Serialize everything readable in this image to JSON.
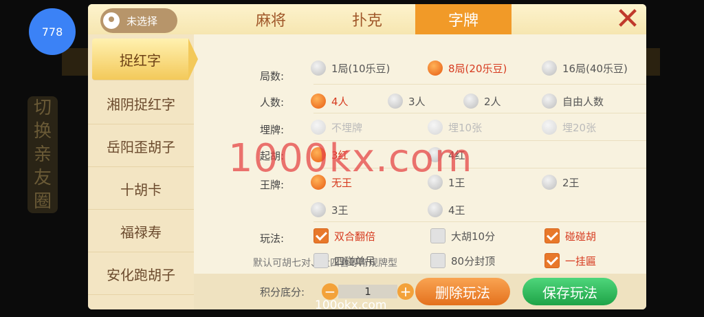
{
  "avatar": {
    "badge": "778"
  },
  "background": {
    "side_label": [
      "切",
      "换",
      "亲",
      "友",
      "圈"
    ]
  },
  "header": {
    "location": "未选择",
    "tabs": [
      {
        "label": "麻将"
      },
      {
        "label": "扑克"
      },
      {
        "label": "字牌"
      }
    ],
    "active_tab": "字牌"
  },
  "sidebar": {
    "items": [
      {
        "label": "捉红字",
        "active": true
      },
      {
        "label": "湘阴捉红字"
      },
      {
        "label": "岳阳歪胡子"
      },
      {
        "label": "十胡卡"
      },
      {
        "label": "福禄寿"
      },
      {
        "label": "安化跑胡子"
      }
    ]
  },
  "settings": {
    "rounds": {
      "label": "局数:",
      "options": [
        "1局(10乐豆)",
        "8局(20乐豆)",
        "16局(40乐豆)"
      ],
      "selected": "8局(20乐豆)"
    },
    "players": {
      "label": "人数:",
      "options": [
        "4人",
        "3人",
        "2人",
        "自由人数"
      ],
      "selected": "4人"
    },
    "bury": {
      "label": "埋牌:",
      "options": [
        "不埋牌",
        "埋10张",
        "埋20张"
      ]
    },
    "start_hu": {
      "label": "起胡:",
      "options": [
        "3红",
        "4红"
      ],
      "selected": "3红"
    },
    "king": {
      "label": "王牌:",
      "options": [
        "无王",
        "1王",
        "2王",
        "3王",
        "4王"
      ],
      "selected": "无王"
    },
    "play": {
      "label": "玩法:",
      "checks": [
        {
          "label": "双合翻倍",
          "checked": true
        },
        {
          "label": "大胡10分",
          "checked": false
        },
        {
          "label": "碰碰胡",
          "checked": true
        },
        {
          "label": "四碰单吊",
          "checked": false
        },
        {
          "label": "80分封顶",
          "checked": false
        },
        {
          "label": "一挂匾",
          "checked": true
        }
      ],
      "note": "默认可胡七对、大四喜等常规牌型"
    }
  },
  "footer": {
    "score_label": "积分底分:",
    "score_value": "1",
    "minus": "−",
    "plus": "+",
    "delete_label": "删除玩法",
    "save_label": "保存玩法"
  },
  "watermark": {
    "big": "1000kx.com",
    "small": "100okx.com"
  },
  "close": "✕",
  "colors": {
    "accent": "#f19a28",
    "selected_text": "#d63a1f",
    "save": "#1fa347",
    "delete": "#e4711d"
  }
}
